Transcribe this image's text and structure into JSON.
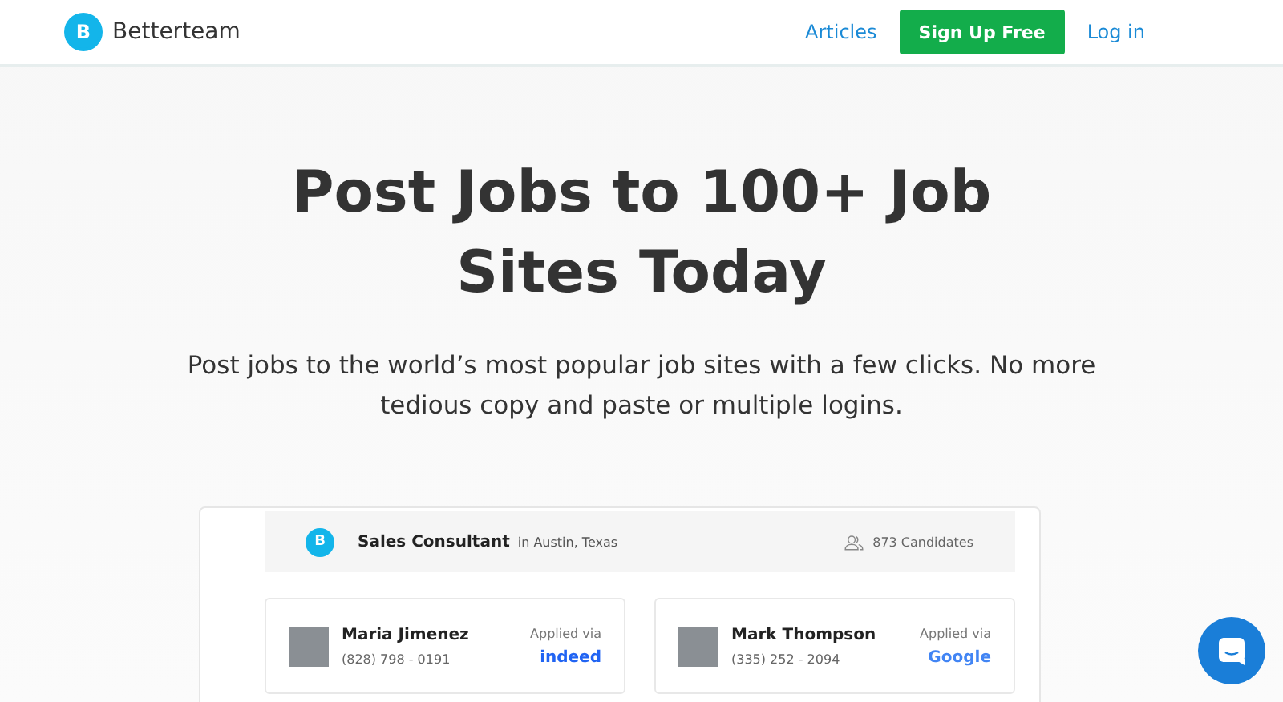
{
  "header": {
    "brand": "Betterteam",
    "logo_letter": "B",
    "nav": [
      {
        "label": "Articles",
        "kind": "link"
      },
      {
        "label": "Sign Up Free",
        "kind": "button"
      },
      {
        "label": "Log in",
        "kind": "link"
      }
    ]
  },
  "hero": {
    "title": "Post Jobs to 100+ Job Sites Today",
    "subtitle": "Post jobs to the world’s most popular job sites with a few clicks. No more tedious copy and paste or multiple logins."
  },
  "job": {
    "logo_letter": "B",
    "title": "Sales Consultant",
    "location": "in Austin, Texas",
    "candidates": "873 Candidates"
  },
  "applicants": [
    {
      "name": "Maria Jimenez",
      "phone": "(828) 798 - 0191",
      "applied_label": "Applied via",
      "source": "indeed",
      "kind": "indeed"
    },
    {
      "name": "Mark Thompson",
      "phone": "(335) 252 - 2094",
      "applied_label": "Applied via",
      "source": "Google",
      "kind": "google"
    }
  ]
}
